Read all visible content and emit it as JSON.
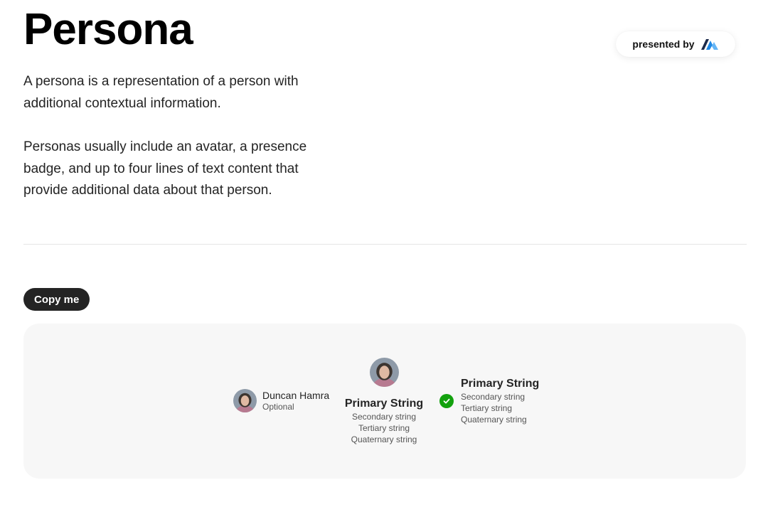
{
  "page": {
    "title": "Persona",
    "description_1": "A persona is a representation of a person with additional contextual information.",
    "description_2": "Personas usually include an avatar, a presence badge, and up to four lines of text content that provide additional data about that person."
  },
  "badge": {
    "label": "presented by",
    "logo_icon": "brand-logo-icon"
  },
  "copy_button": {
    "label": "Copy me"
  },
  "examples": {
    "small": {
      "name": "Duncan Hamra",
      "secondary": "Optional",
      "avatar_icon": "avatar-photo"
    },
    "centered": {
      "primary": "Primary String",
      "secondary": "Secondary string",
      "tertiary": "Tertiary string",
      "quaternary": "Quaternary string",
      "avatar_icon": "avatar-photo"
    },
    "presence": {
      "primary": "Primary String",
      "secondary": "Secondary string",
      "tertiary": "Tertiary string",
      "quaternary": "Quaternary string",
      "presence_icon": "available-check-icon",
      "presence_color": "#13a10e"
    }
  },
  "colors": {
    "button_bg": "#242424",
    "panel_bg": "#f7f7f7",
    "presence": "#13a10e"
  }
}
